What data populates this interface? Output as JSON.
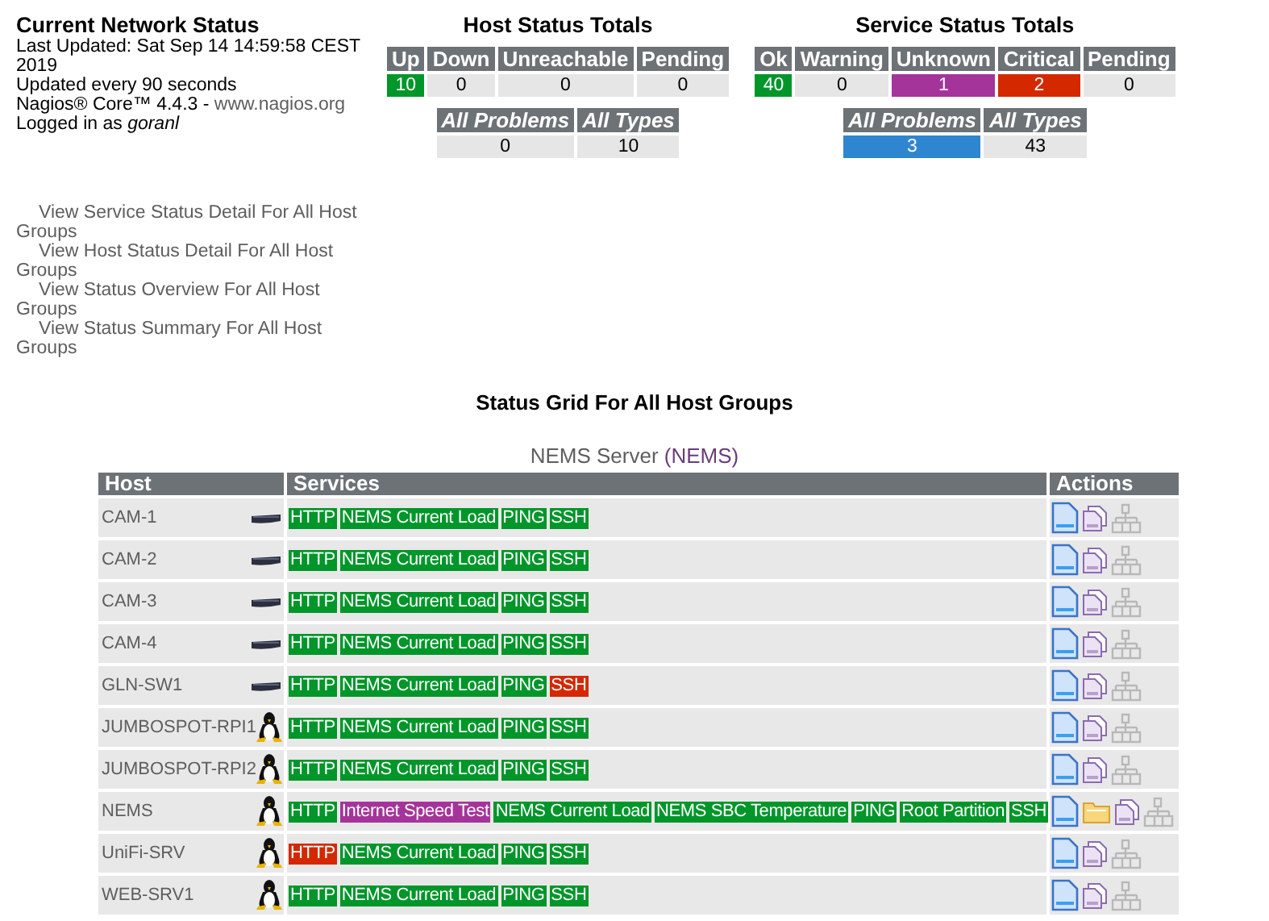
{
  "info": {
    "title": "Current Network Status",
    "last_updated": "Last Updated: Sat Sep 14 14:59:58 CEST 2019",
    "refresh": "Updated every 90 seconds",
    "version": "Nagios® Core™ 4.4.3 - ",
    "version_link": "www.nagios.org",
    "logged_in": "Logged in as ",
    "user": "goranl"
  },
  "links": [
    "View Service Status Detail For All Host Groups",
    "View Host Status Detail For All Host Groups",
    "View Status Overview For All Host Groups",
    "View Status Summary For All Host Groups"
  ],
  "host_totals": {
    "title": "Host Status Totals",
    "states": [
      {
        "label": "Up",
        "value": "10",
        "kind": "up"
      },
      {
        "label": "Down",
        "value": "0",
        "kind": "none"
      },
      {
        "label": "Unreachable",
        "value": "0",
        "kind": "none"
      },
      {
        "label": "Pending",
        "value": "0",
        "kind": "none"
      }
    ],
    "summary": [
      {
        "label": "All Problems",
        "value": "0",
        "kind": "none"
      },
      {
        "label": "All Types",
        "value": "10",
        "kind": "none"
      }
    ]
  },
  "service_totals": {
    "title": "Service Status Totals",
    "states": [
      {
        "label": "Ok",
        "value": "40",
        "kind": "up"
      },
      {
        "label": "Warning",
        "value": "0",
        "kind": "none"
      },
      {
        "label": "Unknown",
        "value": "1",
        "kind": "unknown"
      },
      {
        "label": "Critical",
        "value": "2",
        "kind": "critical"
      },
      {
        "label": "Pending",
        "value": "0",
        "kind": "none"
      }
    ],
    "summary": [
      {
        "label": "All Problems",
        "value": "3",
        "kind": "problem"
      },
      {
        "label": "All Types",
        "value": "43",
        "kind": "none"
      }
    ]
  },
  "grid_title": "Status Grid For All Host Groups",
  "group": {
    "name": "NEMS Server",
    "alias_link": "(NEMS)"
  },
  "table": {
    "columns": [
      "Host",
      "Services",
      "Actions"
    ],
    "rows": [
      {
        "host": "CAM-1",
        "kind": "switch",
        "services": [
          {
            "name": "HTTP",
            "kind": "ok"
          },
          {
            "name": "NEMS Current Load",
            "kind": "ok"
          },
          {
            "name": "PING",
            "kind": "ok"
          },
          {
            "name": "SSH",
            "kind": "ok"
          }
        ],
        "actions": [
          {
            "kind": "details"
          },
          {
            "kind": "notes"
          },
          {
            "kind": "map"
          }
        ]
      },
      {
        "host": "CAM-2",
        "kind": "switch",
        "services": [
          {
            "name": "HTTP",
            "kind": "ok"
          },
          {
            "name": "NEMS Current Load",
            "kind": "ok"
          },
          {
            "name": "PING",
            "kind": "ok"
          },
          {
            "name": "SSH",
            "kind": "ok"
          }
        ],
        "actions": [
          {
            "kind": "details"
          },
          {
            "kind": "notes"
          },
          {
            "kind": "map"
          }
        ]
      },
      {
        "host": "CAM-3",
        "kind": "switch",
        "services": [
          {
            "name": "HTTP",
            "kind": "ok"
          },
          {
            "name": "NEMS Current Load",
            "kind": "ok"
          },
          {
            "name": "PING",
            "kind": "ok"
          },
          {
            "name": "SSH",
            "kind": "ok"
          }
        ],
        "actions": [
          {
            "kind": "details"
          },
          {
            "kind": "notes"
          },
          {
            "kind": "map"
          }
        ]
      },
      {
        "host": "CAM-4",
        "kind": "switch",
        "services": [
          {
            "name": "HTTP",
            "kind": "ok"
          },
          {
            "name": "NEMS Current Load",
            "kind": "ok"
          },
          {
            "name": "PING",
            "kind": "ok"
          },
          {
            "name": "SSH",
            "kind": "ok"
          }
        ],
        "actions": [
          {
            "kind": "details"
          },
          {
            "kind": "notes"
          },
          {
            "kind": "map"
          }
        ]
      },
      {
        "host": "GLN-SW1",
        "kind": "switch",
        "services": [
          {
            "name": "HTTP",
            "kind": "ok"
          },
          {
            "name": "NEMS Current Load",
            "kind": "ok"
          },
          {
            "name": "PING",
            "kind": "ok"
          },
          {
            "name": "SSH",
            "kind": "critical"
          }
        ],
        "actions": [
          {
            "kind": "details"
          },
          {
            "kind": "notes"
          },
          {
            "kind": "map"
          }
        ]
      },
      {
        "host": "JUMBOSPOT-RPI1",
        "kind": "linux",
        "services": [
          {
            "name": "HTTP",
            "kind": "ok"
          },
          {
            "name": "NEMS Current Load",
            "kind": "ok"
          },
          {
            "name": "PING",
            "kind": "ok"
          },
          {
            "name": "SSH",
            "kind": "ok"
          }
        ],
        "actions": [
          {
            "kind": "details"
          },
          {
            "kind": "notes"
          },
          {
            "kind": "map"
          }
        ]
      },
      {
        "host": "JUMBOSPOT-RPI2",
        "kind": "linux",
        "services": [
          {
            "name": "HTTP",
            "kind": "ok"
          },
          {
            "name": "NEMS Current Load",
            "kind": "ok"
          },
          {
            "name": "PING",
            "kind": "ok"
          },
          {
            "name": "SSH",
            "kind": "ok"
          }
        ],
        "actions": [
          {
            "kind": "details"
          },
          {
            "kind": "notes"
          },
          {
            "kind": "map"
          }
        ]
      },
      {
        "host": "NEMS",
        "kind": "linux",
        "services": [
          {
            "name": "HTTP",
            "kind": "ok"
          },
          {
            "name": "Internet Speed Test",
            "kind": "unknown"
          },
          {
            "name": "NEMS Current Load",
            "kind": "ok"
          },
          {
            "name": "NEMS SBC Temperature",
            "kind": "ok"
          },
          {
            "name": "PING",
            "kind": "ok"
          },
          {
            "name": "Root Partition",
            "kind": "ok"
          },
          {
            "name": "SSH",
            "kind": "ok"
          }
        ],
        "actions": [
          {
            "kind": "details"
          },
          {
            "kind": "folder"
          },
          {
            "kind": "notes"
          },
          {
            "kind": "map"
          }
        ]
      },
      {
        "host": "UniFi-SRV",
        "kind": "linux",
        "services": [
          {
            "name": "HTTP",
            "kind": "critical"
          },
          {
            "name": "NEMS Current Load",
            "kind": "ok"
          },
          {
            "name": "PING",
            "kind": "ok"
          },
          {
            "name": "SSH",
            "kind": "ok"
          }
        ],
        "actions": [
          {
            "kind": "details"
          },
          {
            "kind": "notes"
          },
          {
            "kind": "map"
          }
        ]
      },
      {
        "host": "WEB-SRV1",
        "kind": "linux",
        "services": [
          {
            "name": "HTTP",
            "kind": "ok"
          },
          {
            "name": "NEMS Current Load",
            "kind": "ok"
          },
          {
            "name": "PING",
            "kind": "ok"
          },
          {
            "name": "SSH",
            "kind": "ok"
          }
        ],
        "actions": [
          {
            "kind": "details"
          },
          {
            "kind": "notes"
          },
          {
            "kind": "map"
          }
        ]
      }
    ]
  }
}
